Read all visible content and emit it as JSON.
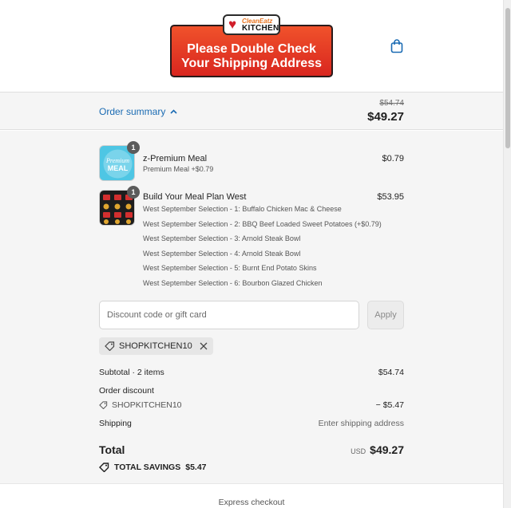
{
  "header": {
    "logo_word1": "CleanEatz",
    "logo_word2": "KITCHEN",
    "banner_line1": "Please Double Check",
    "banner_line2": "Your Shipping Address"
  },
  "summary": {
    "toggle_label": "Order summary",
    "original_total": "$54.74",
    "total": "$49.27"
  },
  "items": [
    {
      "title": "z-Premium Meal",
      "subtitle": "Premium Meal +$0.79",
      "price": "$0.79",
      "qty": "1",
      "thumb_text": "Premium MEAL"
    },
    {
      "title": "Build Your Meal Plan West",
      "price": "$53.95",
      "qty": "1",
      "selections": [
        "West September Selection - 1: Buffalo Chicken Mac & Cheese",
        "West September Selection - 2: BBQ Beef Loaded Sweet Potatoes (+$0.79)",
        "West September Selection - 3: Arnold Steak Bowl",
        "West September Selection - 4: Arnold Steak Bowl",
        "West September Selection - 5: Burnt End Potato Skins",
        "West September Selection - 6: Bourbon Glazed Chicken"
      ]
    }
  ],
  "discount": {
    "placeholder": "Discount code or gift card",
    "apply_label": "Apply",
    "applied_code": "SHOPKITCHEN10"
  },
  "totals": {
    "subtotal_label": "Subtotal · 2 items",
    "subtotal_value": "$54.74",
    "order_discount_label": "Order discount",
    "discount_code": "SHOPKITCHEN10",
    "discount_value": "− $5.47",
    "shipping_label": "Shipping",
    "shipping_value": "Enter shipping address",
    "total_label": "Total",
    "currency": "USD",
    "total_value": "$49.27",
    "savings_label": "TOTAL SAVINGS",
    "savings_value": "$5.47"
  },
  "footer": {
    "express_label": "Express checkout"
  },
  "colors": {
    "accent_link": "#1a6bb3",
    "banner_red": "#e23a24",
    "panel_bg": "#f5f5f5"
  }
}
